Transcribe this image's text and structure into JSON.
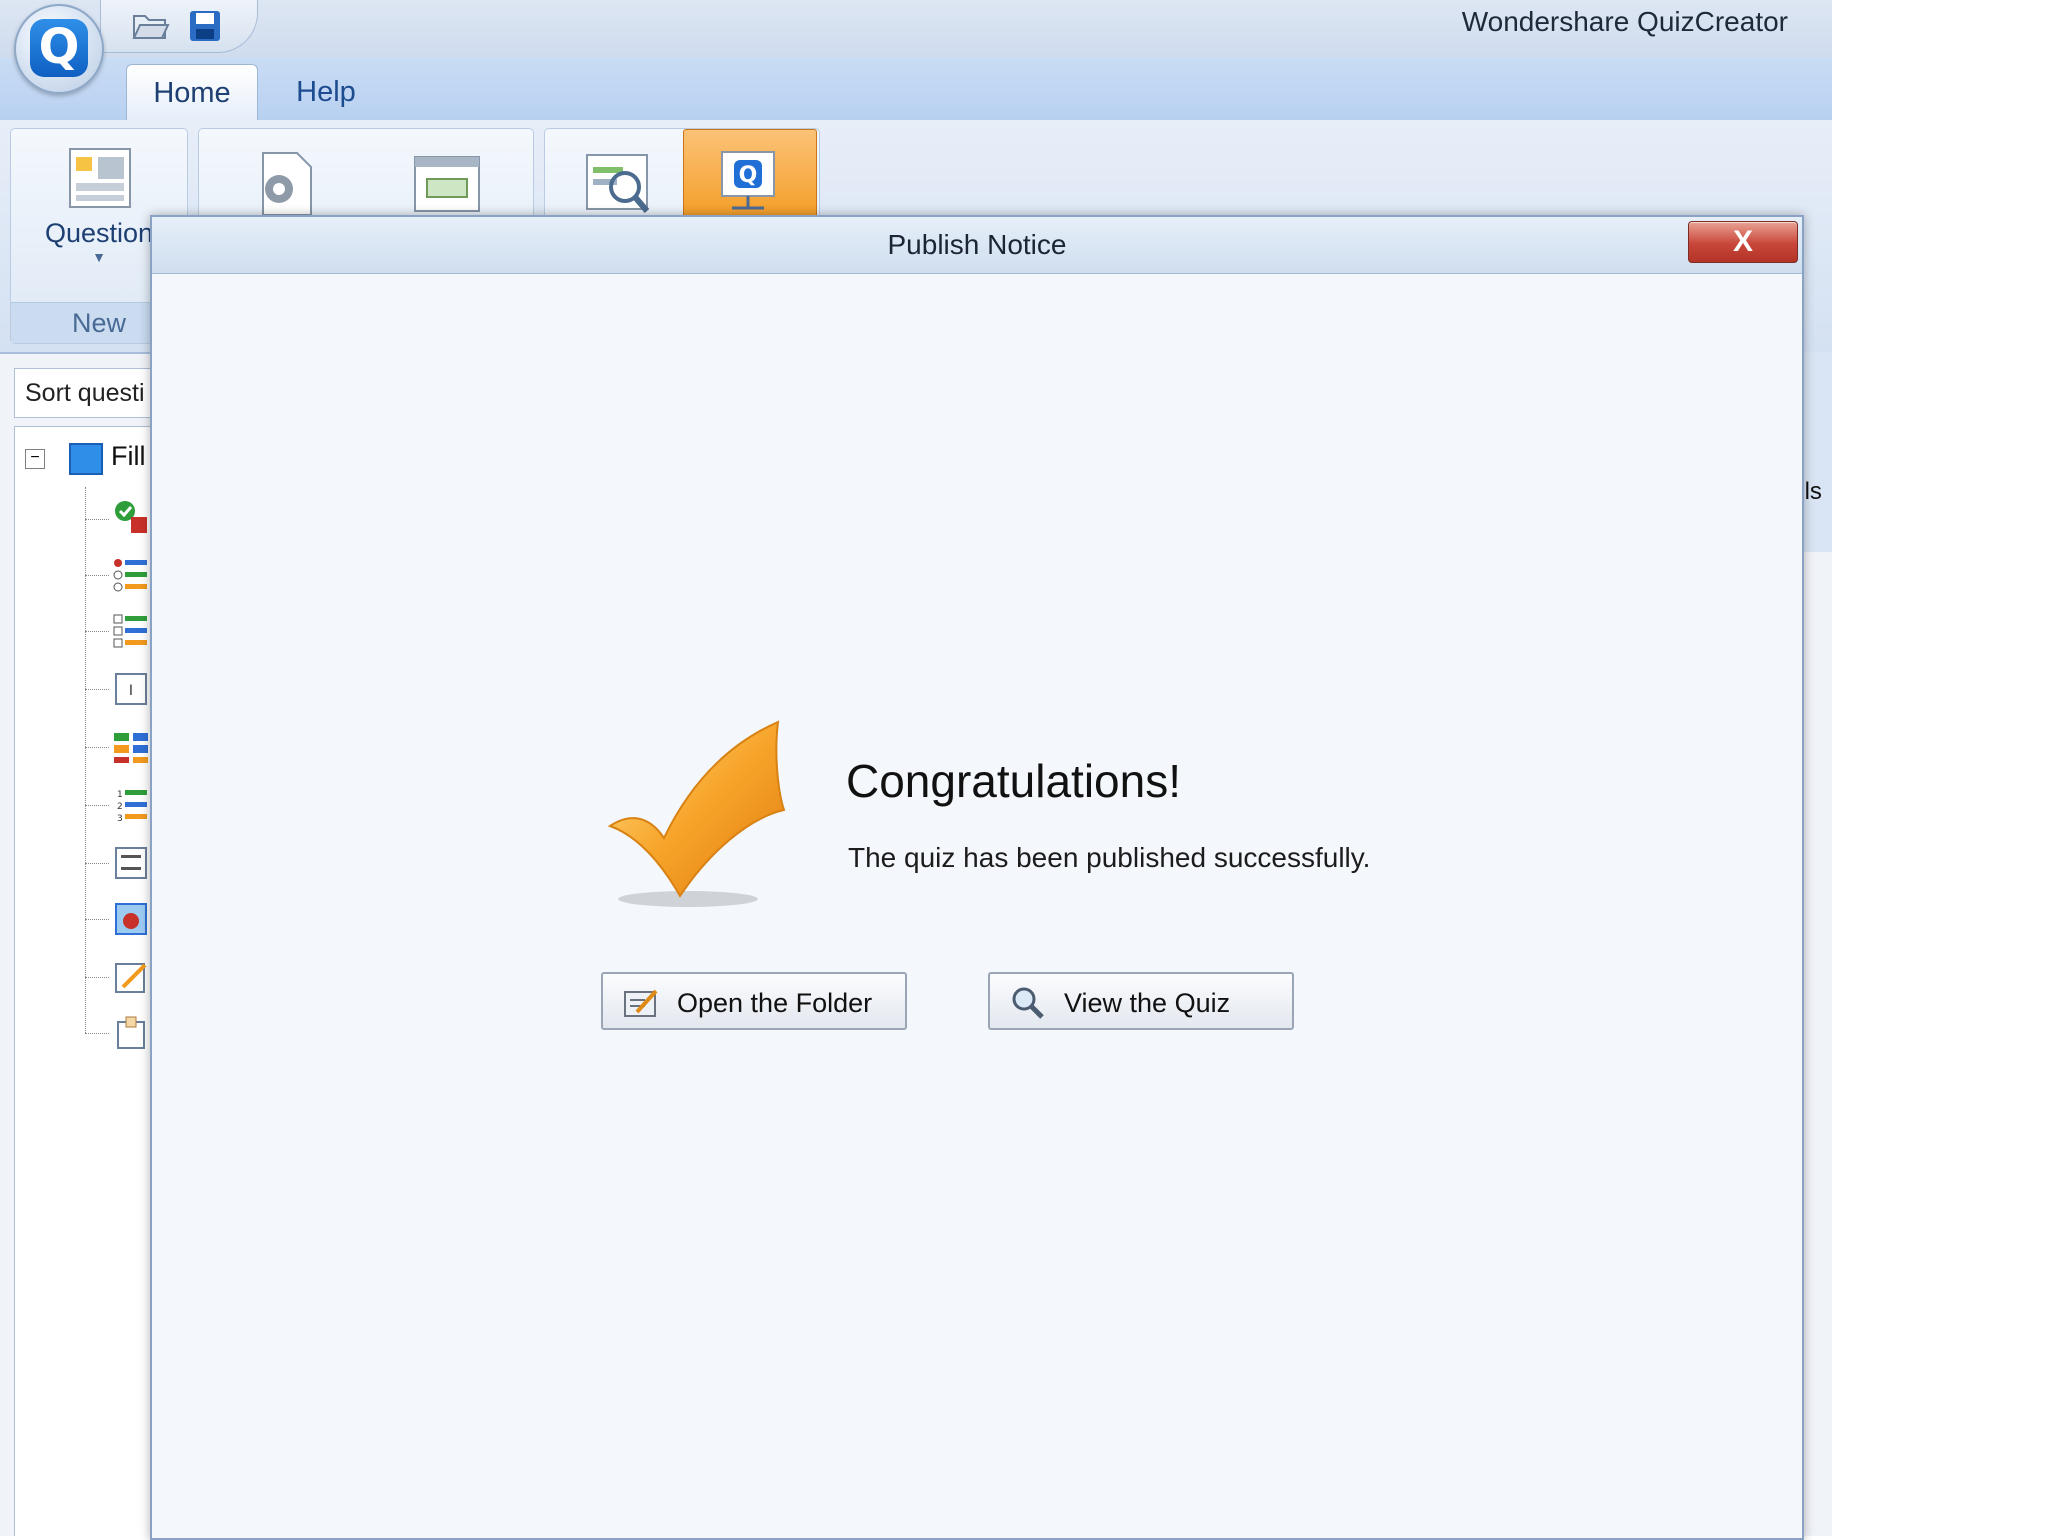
{
  "window": {
    "title": "Wondershare QuizCreator"
  },
  "ribbon": {
    "tabs": [
      {
        "label": "Home",
        "active": true
      },
      {
        "label": "Help",
        "active": false
      }
    ],
    "question_button_label": "Question",
    "new_group_label": "New"
  },
  "left_pane": {
    "sort_label": "Sort questi",
    "tree_root_label": "Fill"
  },
  "right_strip": {
    "text": "'ls"
  },
  "dialog": {
    "title": "Publish Notice",
    "close_label": "X",
    "heading": "Congratulations!",
    "message": "The quiz has been published successfully.",
    "buttons": {
      "open_folder": "Open the Folder",
      "view_quiz": "View the Quiz"
    }
  },
  "colors": {
    "accent_orange": "#f39a1e",
    "ribbon_blue": "#c9dcf5",
    "close_red": "#c8463a"
  },
  "icons": {
    "app": "quizcreator-logo-icon",
    "open": "folder-open-icon",
    "save": "save-icon",
    "check": "checkmark-icon",
    "folder_button": "edit-folder-icon",
    "view_button": "magnifier-icon"
  }
}
